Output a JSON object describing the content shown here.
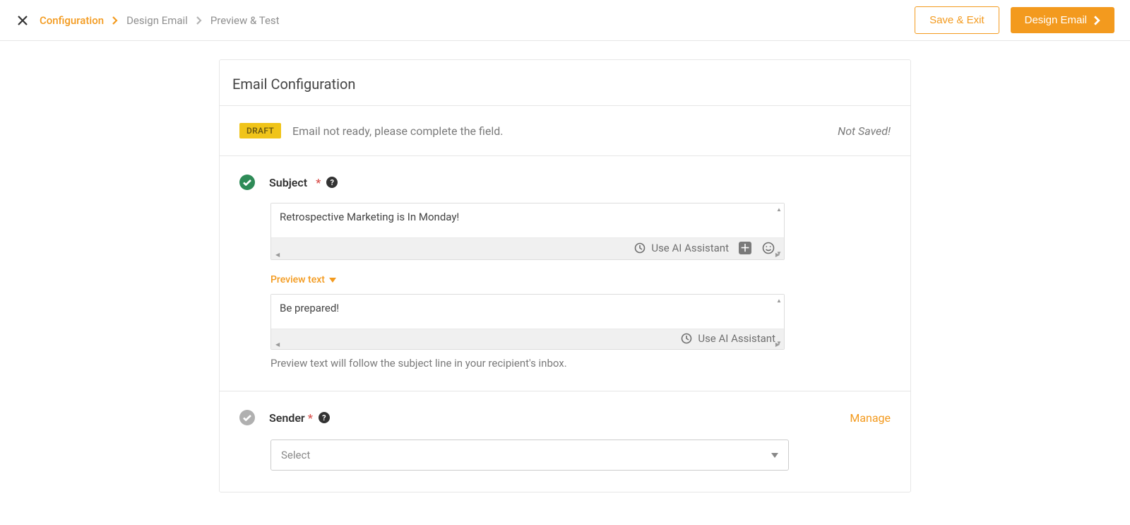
{
  "breadcrumb": {
    "step1": "Configuration",
    "step2": "Design Email",
    "step3": "Preview & Test"
  },
  "buttons": {
    "save_exit": "Save & Exit",
    "design_email": "Design Email"
  },
  "card": {
    "heading": "Email Configuration"
  },
  "status": {
    "badge": "DRAFT",
    "message": "Email not ready, please complete the field.",
    "saved_state": "Not Saved!"
  },
  "subject": {
    "label": "Subject",
    "required_mark": "*",
    "help_glyph": "?",
    "value": "Retrospective Marketing is In Monday!",
    "ai_label": "Use AI Assistant",
    "preview_toggle": "Preview text",
    "preview_value": "Be prepared!",
    "preview_ai_label": "Use AI Assistant",
    "hint": "Preview text will follow the subject line in your recipient's inbox."
  },
  "sender": {
    "label": "Sender",
    "required_mark": "*",
    "help_glyph": "?",
    "manage": "Manage",
    "placeholder": "Select"
  }
}
